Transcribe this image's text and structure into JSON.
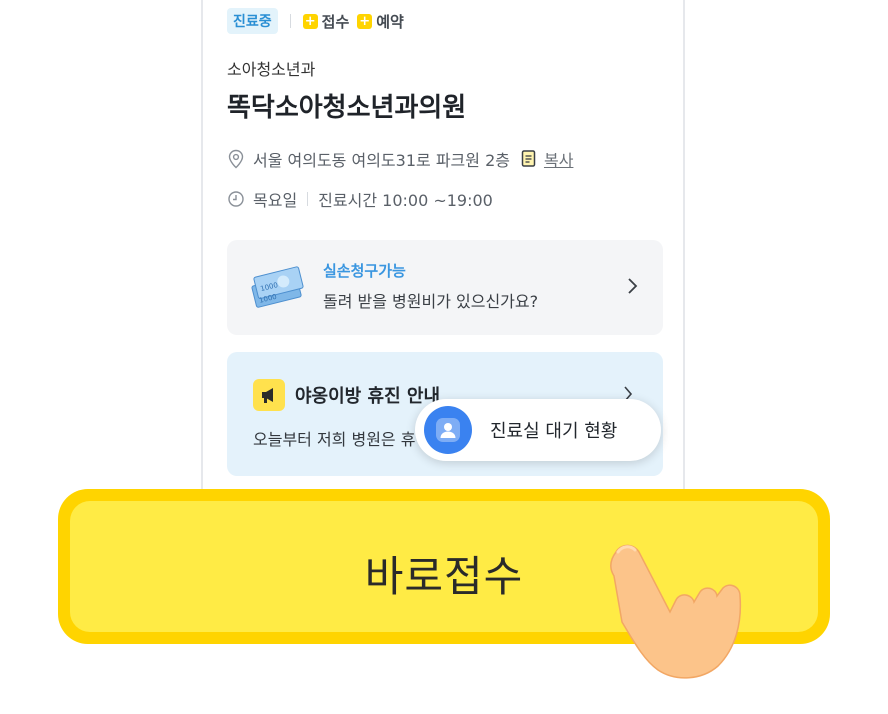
{
  "status": {
    "badge": "진료중",
    "options": [
      {
        "label": "접수"
      },
      {
        "label": "예약"
      }
    ]
  },
  "clinic": {
    "category": "소아청소년과",
    "name": "똑닥소아청소년과의원",
    "address": "서울 여의도동 여의도31로 파크원 2층",
    "copy_label": "복사",
    "day": "목요일",
    "hours": "진료시간 10:00 ~19:00"
  },
  "insurance_card": {
    "title": "실손청구가능",
    "subtitle": "돌려 받을 병원비가 있으신가요?",
    "icon": "money-bills-icon"
  },
  "notice_card": {
    "title": "야옹이방 휴진 안내",
    "body": "오늘부터 저희 병원은 휴",
    "icon": "megaphone-icon"
  },
  "queue_button": {
    "label": "진료실 대기 현황",
    "icon": "person-icon"
  },
  "cta": {
    "label": "바로접수",
    "icon": "pointing-hand-icon"
  },
  "colors": {
    "accent_yellow": "#ffd400",
    "cta_fill": "#ffeb45",
    "blue": "#3a82f0",
    "notice_bg": "#e4f2fb"
  }
}
